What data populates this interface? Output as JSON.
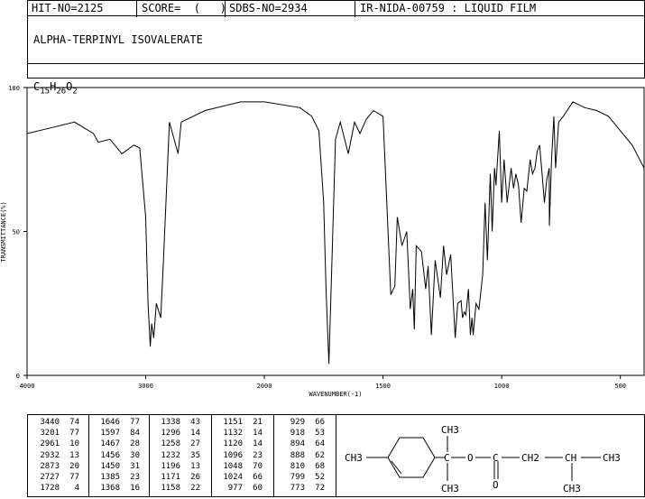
{
  "header": {
    "hit_no": "HIT-NO=2125",
    "score": "SCORE=  (   )",
    "sdbs_no": "SDBS-NO=2934",
    "ir_id": "IR-NIDA-00759 : LIQUID FILM"
  },
  "compound_name": "ALPHA-TERPINYL ISOVALERATE",
  "formula": {
    "c": "C",
    "c_n": "15",
    "h": "H",
    "h_n": "26",
    "o": "O",
    "o_n": "2"
  },
  "chart_data": {
    "type": "line",
    "xlabel": "WAVENUMBER(-1)",
    "ylabel": "TRANSMITTANCE(%)",
    "xlim": [
      4000,
      400
    ],
    "ylim": [
      0,
      100
    ],
    "x_ticks": [
      "4000",
      "3000",
      "2000",
      "1500",
      "1000",
      "500"
    ],
    "y_ticks": [
      "100",
      "50",
      "0"
    ],
    "grid": false,
    "series": [
      {
        "x": [
          4000,
          3800,
          3600,
          3440,
          3400,
          3300,
          3201,
          3100,
          3050,
          3000,
          2980,
          2961,
          2950,
          2932,
          2910,
          2873,
          2850,
          2800,
          2727,
          2700,
          2500,
          2200,
          2000,
          1850,
          1800,
          1770,
          1750,
          1740,
          1728,
          1715,
          1700,
          1680,
          1646,
          1620,
          1597,
          1570,
          1540,
          1500,
          1467,
          1456,
          1450,
          1440,
          1420,
          1400,
          1385,
          1375,
          1368,
          1360,
          1338,
          1320,
          1310,
          1296,
          1280,
          1258,
          1245,
          1232,
          1215,
          1196,
          1185,
          1171,
          1165,
          1158,
          1151,
          1140,
          1132,
          1125,
          1120,
          1108,
          1096,
          1080,
          1070,
          1060,
          1048,
          1040,
          1030,
          1024,
          1010,
          1000,
          990,
          977,
          960,
          950,
          940,
          929,
          920,
          918,
          905,
          894,
          880,
          870,
          860,
          850,
          840,
          830,
          820,
          810,
          800,
          799,
          790,
          780,
          773,
          760,
          740,
          700,
          650,
          600,
          550,
          500,
          450,
          400
        ],
        "y": [
          84,
          86,
          88,
          84,
          81,
          82,
          77,
          80,
          79,
          55,
          25,
          10,
          18,
          13,
          25,
          20,
          40,
          88,
          77,
          88,
          92,
          95,
          95,
          93,
          90,
          85,
          60,
          30,
          4,
          40,
          82,
          88,
          77,
          88,
          84,
          89,
          92,
          90,
          28,
          30,
          31,
          55,
          45,
          50,
          23,
          30,
          16,
          45,
          43,
          30,
          38,
          14,
          40,
          27,
          45,
          35,
          42,
          13,
          25,
          26,
          20,
          22,
          21,
          30,
          14,
          20,
          14,
          25,
          23,
          35,
          60,
          40,
          70,
          50,
          72,
          66,
          85,
          60,
          75,
          60,
          72,
          65,
          70,
          66,
          55,
          53,
          65,
          64,
          75,
          70,
          72,
          78,
          80,
          70,
          60,
          68,
          72,
          52,
          75,
          90,
          72,
          88,
          90,
          95,
          93,
          92,
          90,
          85,
          80,
          72
        ]
      }
    ]
  },
  "peak_table": {
    "columns": [
      [
        [
          "3440",
          "74"
        ],
        [
          "3201",
          "77"
        ],
        [
          "2961",
          "10"
        ],
        [
          "2932",
          "13"
        ],
        [
          "2873",
          "20"
        ],
        [
          "2727",
          "77"
        ],
        [
          "1728",
          "4"
        ]
      ],
      [
        [
          "1646",
          "77"
        ],
        [
          "1597",
          "84"
        ],
        [
          "1467",
          "28"
        ],
        [
          "1456",
          "30"
        ],
        [
          "1450",
          "31"
        ],
        [
          "1385",
          "23"
        ],
        [
          "1368",
          "16"
        ]
      ],
      [
        [
          "1338",
          "43"
        ],
        [
          "1296",
          "14"
        ],
        [
          "1258",
          "27"
        ],
        [
          "1232",
          "35"
        ],
        [
          "1196",
          "13"
        ],
        [
          "1171",
          "26"
        ],
        [
          "1158",
          "22"
        ]
      ],
      [
        [
          "1151",
          "21"
        ],
        [
          "1132",
          "14"
        ],
        [
          "1120",
          "14"
        ],
        [
          "1096",
          "23"
        ],
        [
          "1048",
          "70"
        ],
        [
          "1024",
          "66"
        ],
        [
          "977",
          "60"
        ]
      ],
      [
        [
          "929",
          "66"
        ],
        [
          "918",
          "53"
        ],
        [
          "894",
          "64"
        ],
        [
          "888",
          "62"
        ],
        [
          "810",
          "68"
        ],
        [
          "799",
          "52"
        ],
        [
          "773",
          "72"
        ]
      ]
    ]
  },
  "structure": {
    "ch3_left": "CH3",
    "ch3_top": "CH3",
    "ch3_bottom": "CH3",
    "o_ester": "O",
    "o_carbonyl": "O",
    "ch2": "CH2",
    "ch": "CH",
    "ch3_right": "CH3",
    "ch3_branch": "CH3"
  }
}
